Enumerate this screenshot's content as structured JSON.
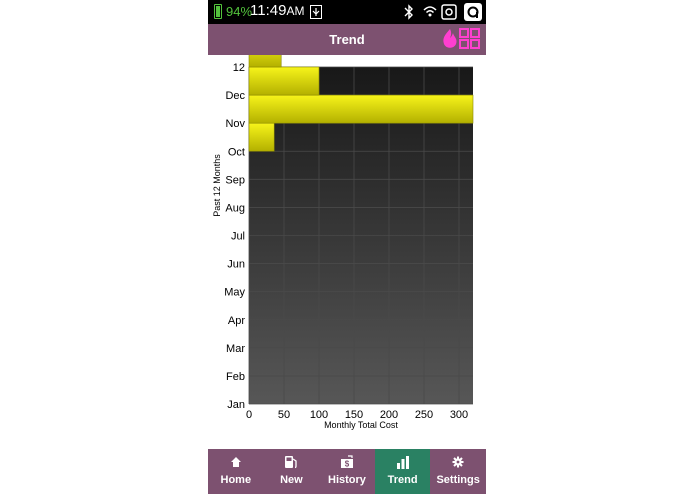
{
  "status_bar": {
    "battery_percent": "94%",
    "time": "11:49",
    "time_suffix": "AM",
    "icons": [
      "battery-icon",
      "usb-icon",
      "bluetooth-icon",
      "wifi-icon",
      "nfc-icon",
      "camera-app-icon"
    ]
  },
  "header": {
    "title": "Trend",
    "app_icon": "flame-grid-icon",
    "accent_color": "#ff3fd0"
  },
  "colors": {
    "header_bg": "#7d5170",
    "nav_bg": "#7d5170",
    "nav_active_bg": "#2a8163",
    "bar_fill_top": "#f7f41a",
    "bar_fill_bottom": "#b3b000",
    "plot_bg_top": "#181818",
    "plot_bg_bottom": "#575757"
  },
  "chart_data": {
    "type": "bar",
    "orientation": "horizontal",
    "xlabel": "Monthly Total Cost",
    "ylabel": "Past 12 Months",
    "xlim": [
      0,
      320
    ],
    "xticks": [
      0,
      50,
      100,
      150,
      200,
      250,
      300
    ],
    "yticks": [
      "Jan",
      "Feb",
      "Mar",
      "Apr",
      "May",
      "Jun",
      "Jul",
      "Aug",
      "Sep",
      "Oct",
      "Nov",
      "Dec",
      "12"
    ],
    "categories": [
      "Jan",
      "Feb",
      "Mar",
      "Apr",
      "May",
      "Jun",
      "Jul",
      "Aug",
      "Sep",
      "Oct",
      "Nov",
      "Dec"
    ],
    "values": [
      0,
      0,
      0,
      0,
      0,
      0,
      0,
      0,
      36,
      320,
      100,
      46
    ],
    "grid": true
  },
  "nav": {
    "items": [
      {
        "label": "Home",
        "icon": "home-icon",
        "active": false
      },
      {
        "label": "New",
        "icon": "fuel-pump-icon",
        "active": false
      },
      {
        "label": "History",
        "icon": "history-icon",
        "active": false
      },
      {
        "label": "Trend",
        "icon": "bar-chart-icon",
        "active": true
      },
      {
        "label": "Settings",
        "icon": "gear-icon",
        "active": false
      }
    ]
  }
}
